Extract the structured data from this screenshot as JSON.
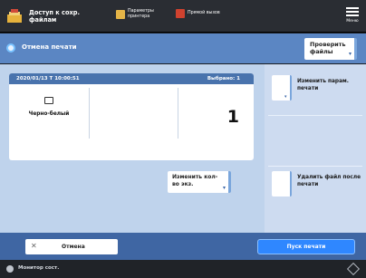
{
  "topbar": {
    "app_title": "Доступ к сохр. файлам",
    "item_a": "Параметры принтера",
    "item_b": "Прямой вызов",
    "menu_label": "Меню"
  },
  "header": {
    "title": "Отмена печати",
    "check_files_label": "Проверить файлы"
  },
  "job": {
    "datetime": "2020/01/13 T 10:00:51",
    "selected_label": "Выбрано: 1",
    "color_mode": "Черно-белый",
    "copies": "1",
    "change_copies_label": "Изменить кол-во экз."
  },
  "side": {
    "change_settings_label": "Изменить парам. печати",
    "delete_after_label": "Удалить файл после печати"
  },
  "actions": {
    "cancel_label": "Отмена",
    "start_label": "Пуск печати"
  },
  "status": {
    "text": "Монитор сост."
  },
  "colors": {
    "header_blue": "#5b86c3",
    "panel_blue": "#bfd3ec",
    "action_blue": "#3f66a3",
    "start_blue": "#2f87ff"
  }
}
